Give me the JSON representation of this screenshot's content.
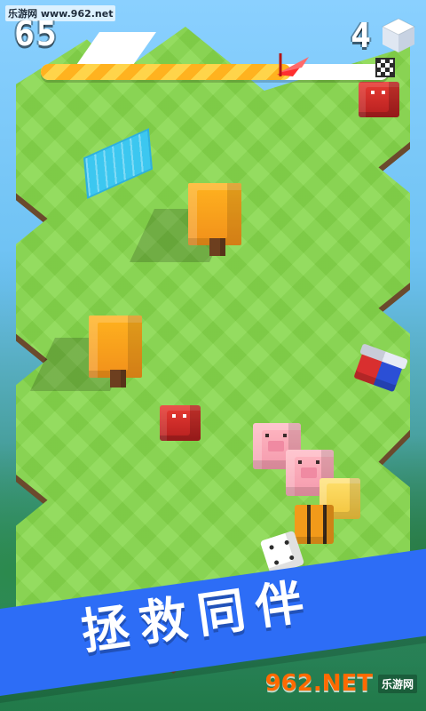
{
  "watermark": {
    "top_site": "乐游网 www.962.net",
    "bottom_logo": "962.NET",
    "bottom_sub": "乐游网"
  },
  "hud": {
    "score": "65",
    "cube_count": "4",
    "progress": 0.72,
    "icons": {
      "cube": "cube-icon",
      "finish_flag": "checkered-flag-icon",
      "progress_marker": "red-flag-icon"
    },
    "colors": {
      "progress_fill_a": "#ffb21f",
      "progress_fill_b": "#ffd44a",
      "progress_bg": "#ffffff"
    }
  },
  "banner": {
    "text": "拯救同伴",
    "color": "#2d6df6"
  },
  "scene": {
    "objects": [
      {
        "name": "tree-canopy-1",
        "type": "tree"
      },
      {
        "name": "tree-canopy-2",
        "type": "tree"
      },
      {
        "name": "red-cube-1",
        "type": "enemy"
      },
      {
        "name": "red-cube-2",
        "type": "enemy"
      },
      {
        "name": "pig-companion-1",
        "type": "companion"
      },
      {
        "name": "pig-companion-2",
        "type": "companion"
      },
      {
        "name": "chick-companion",
        "type": "companion"
      },
      {
        "name": "bee-companion",
        "type": "companion"
      },
      {
        "name": "dice-player",
        "type": "player"
      },
      {
        "name": "magnet-powerup",
        "type": "powerup"
      },
      {
        "name": "water-tile",
        "type": "hazard"
      }
    ]
  }
}
